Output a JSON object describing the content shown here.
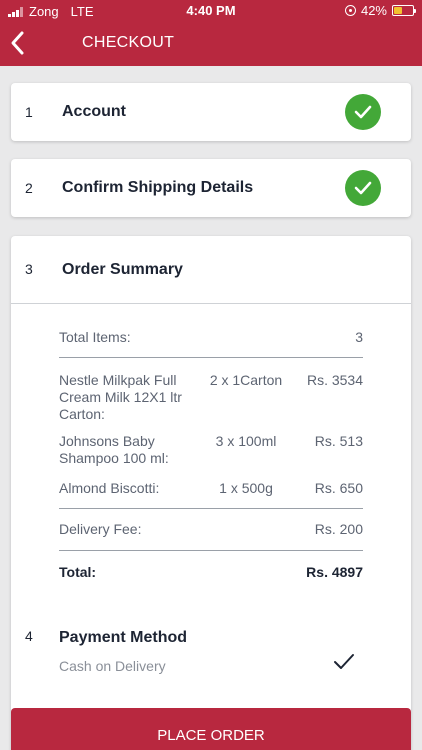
{
  "status_bar": {
    "carrier": "Zong",
    "network": "LTE",
    "time": "4:40 PM",
    "battery": "42%",
    "battery_level": 0.42
  },
  "header": {
    "title": "CHECKOUT",
    "back_icon": "chevron-left-icon"
  },
  "steps": [
    {
      "number": "1",
      "title": "Account",
      "done": true
    },
    {
      "number": "2",
      "title": "Confirm Shipping Details",
      "done": true
    },
    {
      "number": "3",
      "title": "Order Summary"
    },
    {
      "number": "4",
      "title": "Payment Method"
    }
  ],
  "summary": {
    "total_items_label": "Total Items:",
    "total_items_value": "3",
    "items": [
      {
        "name": "Nestle Milkpak Full Cream Milk 12X1 ltr Carton:",
        "qty": "2 x 1Carton",
        "price": "Rs. 3534"
      },
      {
        "name": "Johnsons Baby Shampoo  100 ml:",
        "qty": "3 x 100ml",
        "price": "Rs. 513"
      },
      {
        "name": "Almond Biscotti:",
        "qty": "1 x 500g",
        "price": "Rs. 650"
      }
    ],
    "delivery_fee_label": "Delivery Fee:",
    "delivery_fee_value": "Rs. 200",
    "total_label": "Total:",
    "total_value": "Rs. 4897"
  },
  "payment": {
    "method": "Cash on Delivery",
    "selected": true
  },
  "actions": {
    "place_order": "PLACE ORDER"
  },
  "colors": {
    "brand": "#b8283f",
    "success": "#43a838",
    "background": "#e9e9ea"
  }
}
